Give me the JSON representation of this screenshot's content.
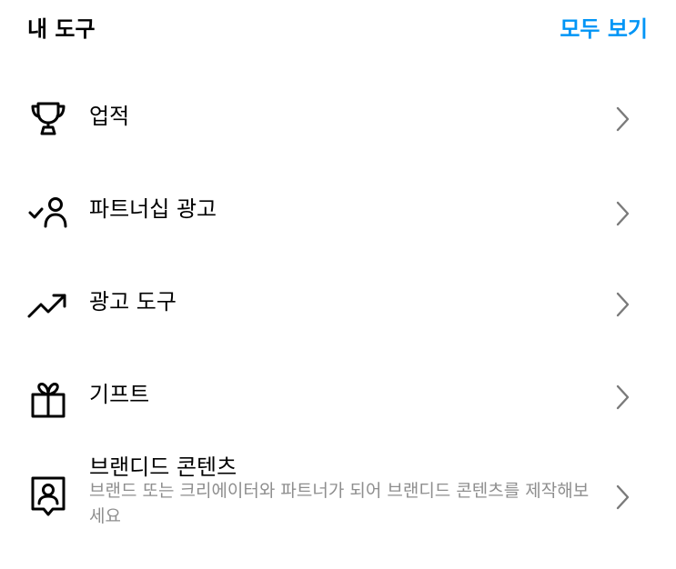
{
  "header": {
    "title": "내 도구",
    "see_all": "모두 보기",
    "accent_color": "#0095f6"
  },
  "items": [
    {
      "label": "업적",
      "icon": "trophy-icon"
    },
    {
      "label": "파트너십 광고",
      "icon": "person-check-icon"
    },
    {
      "label": "광고 도구",
      "icon": "trending-up-icon"
    },
    {
      "label": "기프트",
      "icon": "gift-icon"
    },
    {
      "label": "브랜디드 콘텐츠",
      "description": "브랜드 또는 크리에이터와 파트너가 되어 브랜디드 콘텐츠를 제작해보세요",
      "icon": "branded-content-icon"
    }
  ]
}
